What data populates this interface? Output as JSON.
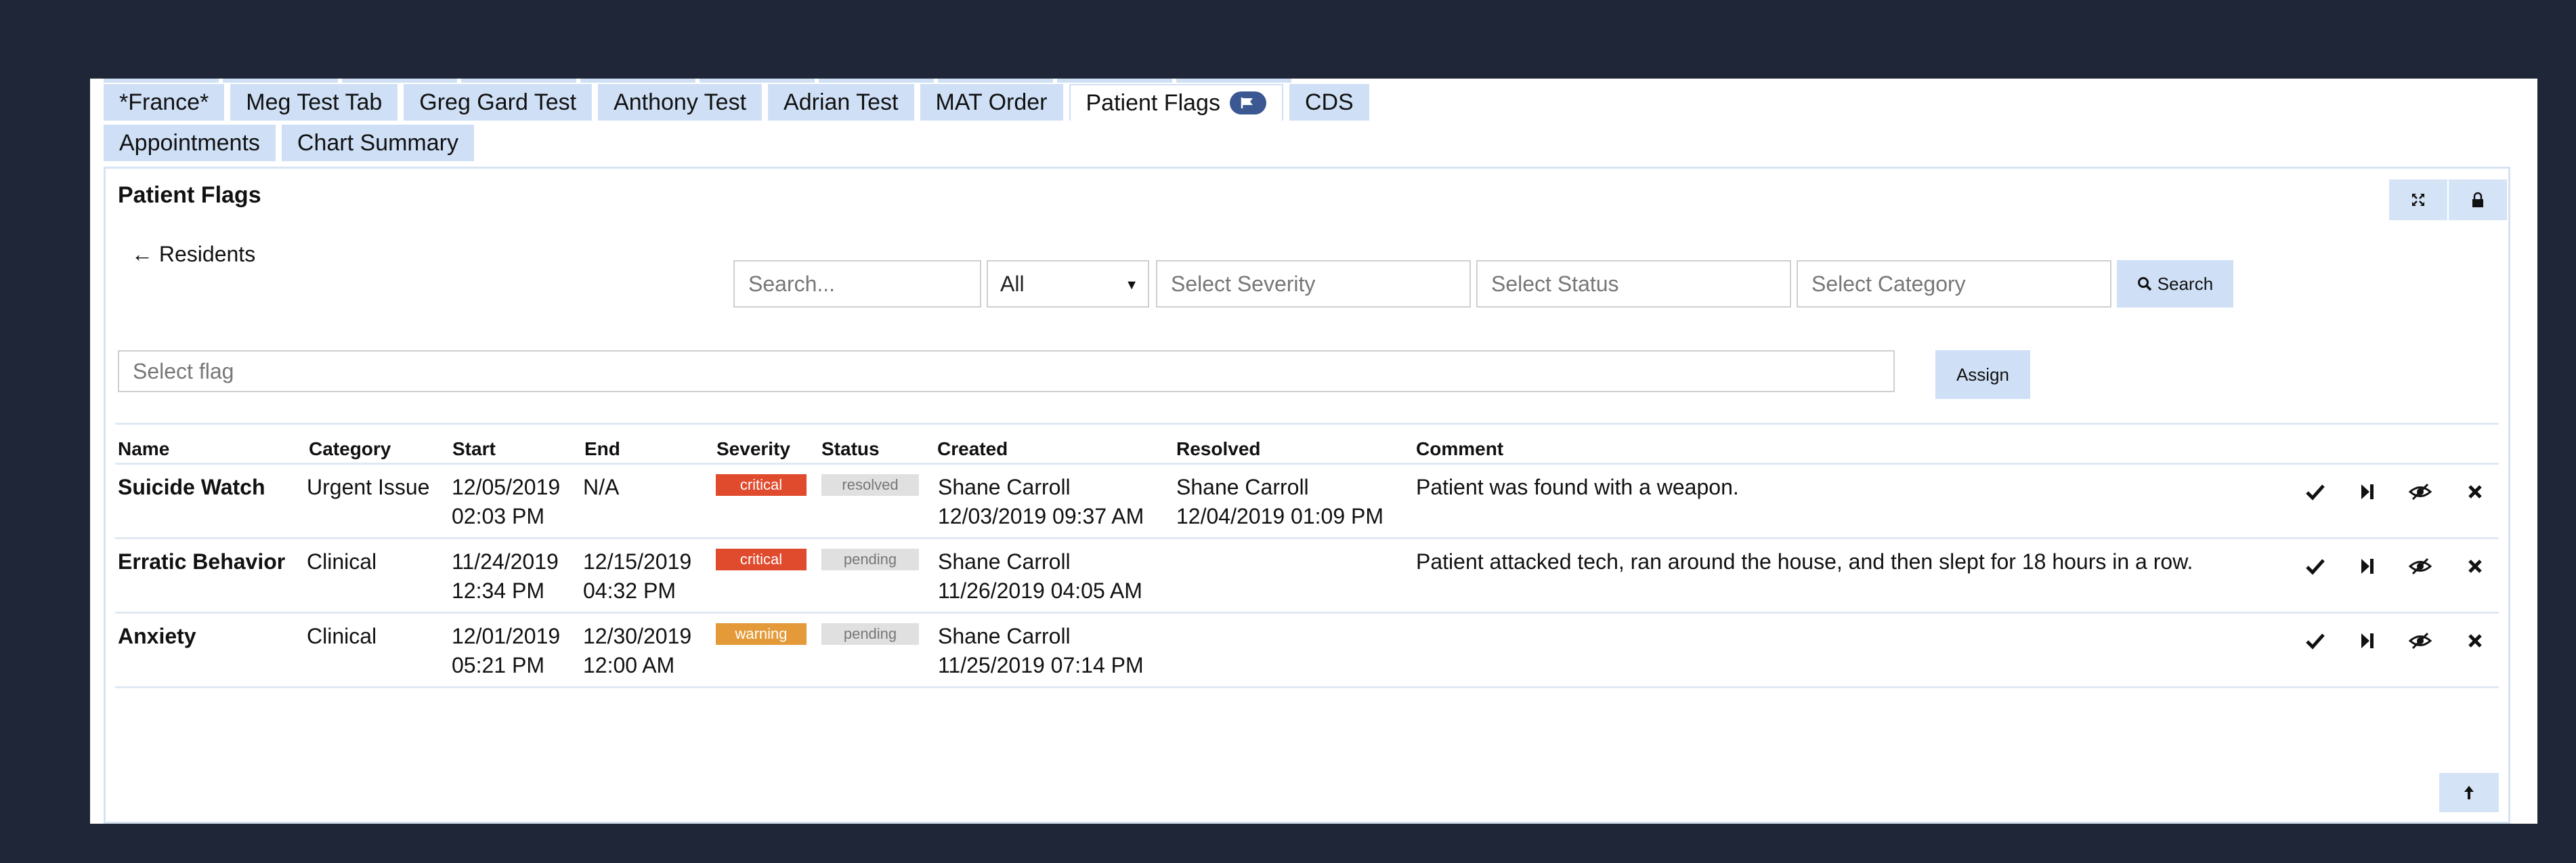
{
  "tabs_row1": [
    "*France*",
    "Meg Test Tab",
    "Greg Gard Test",
    "Anthony Test",
    "Adrian Test",
    "MAT Order",
    "Patient Flags",
    "CDS"
  ],
  "tabs_row2": [
    "Appointments",
    "Chart Summary"
  ],
  "active_tab": "Patient Flags",
  "panel": {
    "title": "Patient Flags",
    "back_link": "← Residents",
    "search_placeholder": "Search...",
    "scope_select": "All",
    "severity_placeholder": "Select Severity",
    "status_placeholder": "Select Status",
    "category_placeholder": "Select Category",
    "search_button": "Search",
    "flag_placeholder": "Select flag",
    "assign_button": "Assign"
  },
  "table": {
    "columns": [
      "Name",
      "Category",
      "Start",
      "End",
      "Severity",
      "Status",
      "Created",
      "Resolved",
      "Comment"
    ],
    "rows": [
      {
        "name": "Suicide Watch",
        "category": "Urgent Issue",
        "start": [
          "12/05/2019",
          "02:03 PM"
        ],
        "end": [
          "N/A",
          ""
        ],
        "severity": "critical",
        "status": "resolved",
        "created": [
          "Shane Carroll",
          "12/03/2019 09:37 AM"
        ],
        "resolved": [
          "Shane Carroll",
          "12/04/2019 01:09 PM"
        ],
        "comment": "Patient was found with a weapon."
      },
      {
        "name": "Erratic Behavior",
        "category": "Clinical",
        "start": [
          "11/24/2019",
          "12:34 PM"
        ],
        "end": [
          "12/15/2019",
          "04:32 PM"
        ],
        "severity": "critical",
        "status": "pending",
        "created": [
          "Shane Carroll",
          "11/26/2019 04:05 AM"
        ],
        "resolved": [
          "",
          ""
        ],
        "comment": "Patient attacked tech, ran around the house, and then slept for 18 hours in a row."
      },
      {
        "name": "Anxiety",
        "category": "Clinical",
        "start": [
          "12/01/2019",
          "05:21 PM"
        ],
        "end": [
          "12/30/2019",
          "12:00 AM"
        ],
        "severity": "warning",
        "status": "pending",
        "created": [
          "Shane Carroll",
          "11/25/2019 07:14 PM"
        ],
        "resolved": [
          "",
          ""
        ],
        "comment": ""
      }
    ],
    "row_actions": [
      "check-icon",
      "skip-forward-icon",
      "hide-icon",
      "close-icon"
    ]
  },
  "colors": {
    "page_background": "#1e2637",
    "tab_background": "#cfe0f6",
    "critical": "#e04a2d",
    "warning": "#e49a38",
    "status_badge": "#e0e0e0",
    "flag_badge": "#3b5893"
  }
}
